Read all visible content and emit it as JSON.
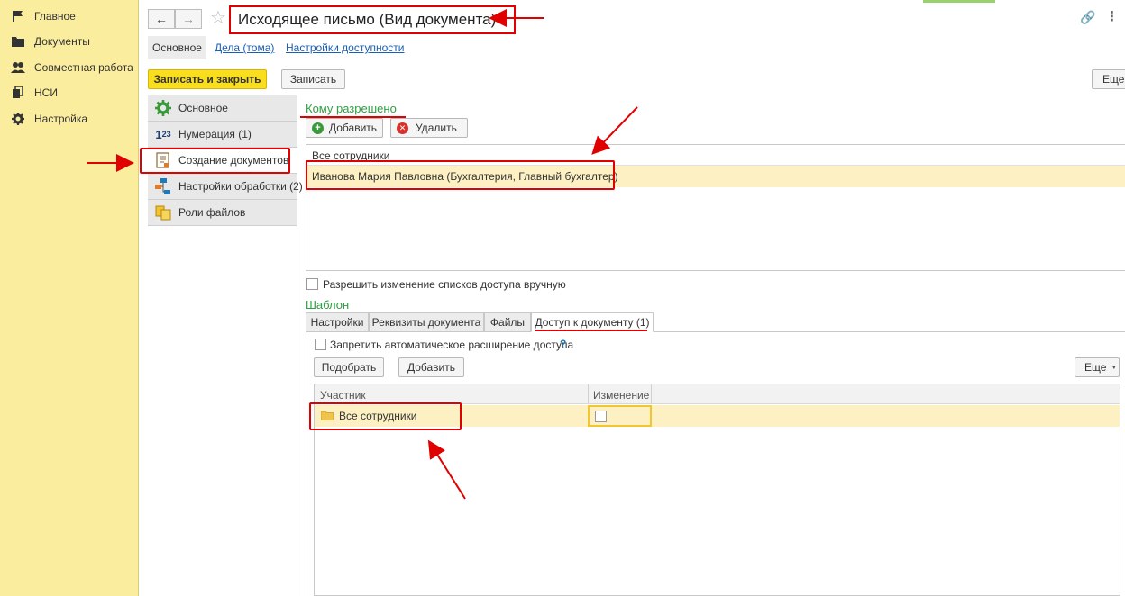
{
  "nav": {
    "items": [
      {
        "label": "Главное",
        "icon": "flag-icon"
      },
      {
        "label": "Документы",
        "icon": "folder-icon"
      },
      {
        "label": "Совместная работа",
        "icon": "people-icon"
      },
      {
        "label": "НСИ",
        "icon": "books-icon"
      },
      {
        "label": "Настройка",
        "icon": "gear-icon"
      }
    ]
  },
  "header": {
    "title": "Исходящее письмо (Вид документа) *"
  },
  "top_tabs": [
    "Основное",
    "Дела (тома)",
    "Настройки доступности"
  ],
  "toolbar": {
    "save_close": "Записать и закрыть",
    "save": "Записать",
    "more": "Еще"
  },
  "side_items": [
    {
      "label": "Основное"
    },
    {
      "label": "Нумерация (1)"
    },
    {
      "label": "Создание документов"
    },
    {
      "label": "Настройки обработки (2)"
    },
    {
      "label": "Роли файлов"
    }
  ],
  "allowed": {
    "heading": "Кому разрешено",
    "add": "Добавить",
    "delete": "Удалить",
    "column": "Все сотрудники",
    "rows": [
      "Иванова Мария Павловна (Бухгалтерия, Главный бухгалтер)"
    ],
    "manual_change": "Разрешить изменение списков доступа вручную"
  },
  "template": {
    "heading": "Шаблон",
    "tabs": [
      "Настройки",
      "Реквизиты документа",
      "Файлы",
      "Доступ к документу (1)"
    ],
    "forbid_auto": "Запретить автоматическое расширение доступа",
    "help": "?",
    "pick": "Подобрать",
    "add": "Добавить",
    "more": "Еще",
    "columns": [
      "Участник",
      "Изменение"
    ],
    "rows": [
      {
        "participant": "Все сотрудники"
      }
    ]
  },
  "colors": {
    "nav_bg": "#fbed9e",
    "accent_yellow": "#f9de1e",
    "section_green": "#2ea043",
    "annotation_red": "#e00000",
    "row_highlight": "#fdf1c4"
  }
}
